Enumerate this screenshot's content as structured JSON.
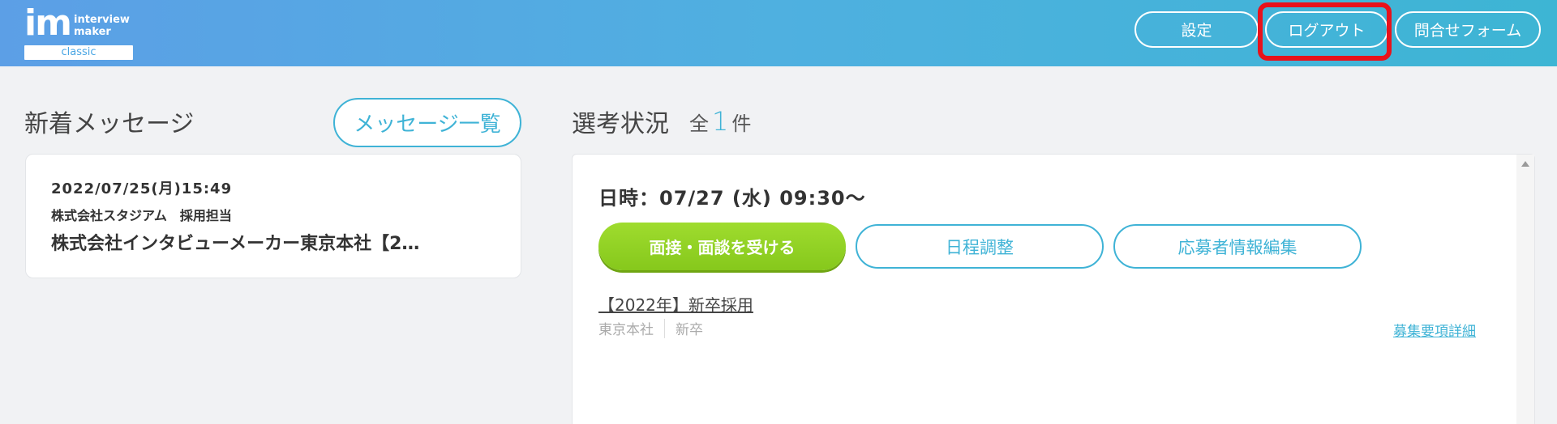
{
  "header": {
    "logo_mark": "im",
    "logo_word1": "interview",
    "logo_word2": "maker",
    "logo_edition": "classic",
    "settings_label": "設定",
    "logout_label": "ログアウト",
    "contact_label": "問合せフォーム",
    "highlight_color": "#e8121b"
  },
  "messages": {
    "title": "新着メッセージ",
    "list_button": "メッセージ一覧",
    "items": [
      {
        "date": "2022/07/25(月)15:49",
        "sender": "株式会社スタジアム　採用担当",
        "subject": "株式会社インタビューメーカー東京本社【2…"
      }
    ]
  },
  "status": {
    "title": "選考状況",
    "count_prefix": "全",
    "count": "1",
    "count_suffix": "件",
    "entries": [
      {
        "datetime": "日時：07/27 (水) 09:30〜",
        "interview_button": "面接・面談を受ける",
        "schedule_button": "日程調整",
        "edit_button": "応募者情報編集",
        "job_title": "【2022年】新卒採用",
        "location": "東京本社",
        "category": "新卒",
        "detail_link": "募集要項詳細"
      }
    ]
  },
  "colors": {
    "accent": "#3fb3d6",
    "primary_button": "#8fd124"
  }
}
